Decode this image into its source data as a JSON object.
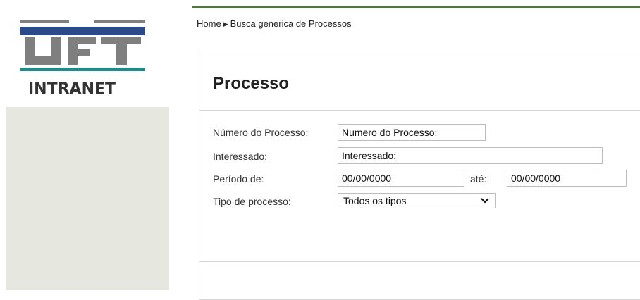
{
  "logo": {
    "text": "UFT",
    "subtitle": "INTRANET",
    "colors": {
      "blue": "#2a4a8a",
      "green": "#1f8a86",
      "gray": "#7f7f7f"
    }
  },
  "breadcrumb": {
    "home": "Home",
    "separator_icon": "chevron-right-icon",
    "current": "Busca generica de Processos"
  },
  "panel": {
    "title": "Processo"
  },
  "form": {
    "numero": {
      "label": "Número do Processo:",
      "value": "Numero do Processo:"
    },
    "interessado": {
      "label": "Interessado:",
      "value": "Interessado:"
    },
    "periodo": {
      "label": "Período de:",
      "from_value": "00/00/0000",
      "ate_label": "até:",
      "to_value": "00/00/0000"
    },
    "tipo": {
      "label": "Tipo de processo:",
      "selected": "Todos os tipos"
    }
  },
  "colors": {
    "topbar": "#4d7a3a",
    "side_panel": "#e6e7de"
  }
}
